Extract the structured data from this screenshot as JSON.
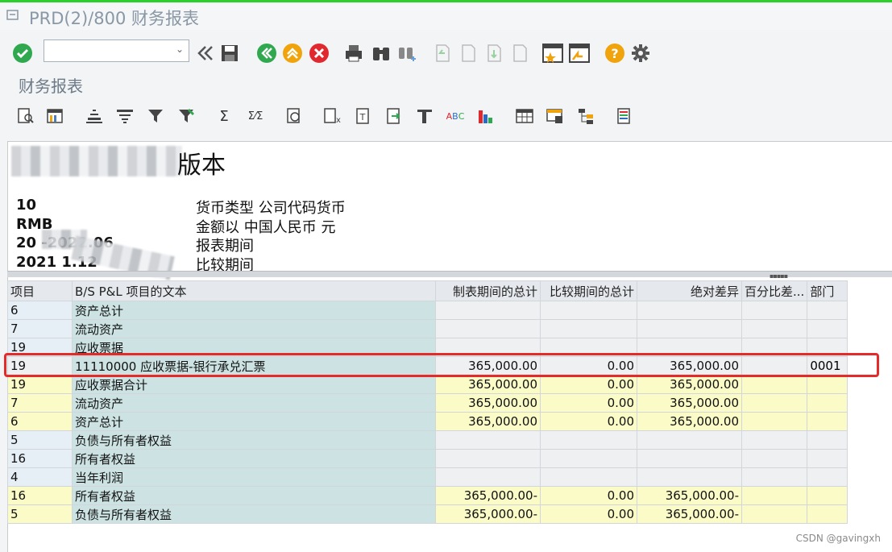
{
  "window": {
    "title": "PRD(2)/800 财务报表",
    "subtitle": "财务报表"
  },
  "command_field": {
    "value": "",
    "placeholder": ""
  },
  "report_header": {
    "title_suffix": "版本",
    "rows": [
      {
        "left": "10",
        "right": "货币类型 公司代码货币"
      },
      {
        "left": "RMB",
        "right": "金额以 中国人民币 元"
      },
      {
        "left": "20      -2022.06",
        "right": "报表期间"
      },
      {
        "left": "2021          1.12",
        "right": "比较期间"
      }
    ]
  },
  "grid": {
    "columns": [
      "项目",
      "B/S P&L 项目的文本",
      "制表期间的总计",
      "比较期间的总计",
      "绝对差异",
      "百分比差...",
      "部门"
    ],
    "rows": [
      {
        "kind": "plain",
        "cells": [
          "6",
          "资产总计",
          "",
          "",
          "",
          "",
          ""
        ]
      },
      {
        "kind": "plain",
        "cells": [
          "7",
          "流动资产",
          "",
          "",
          "",
          "",
          ""
        ]
      },
      {
        "kind": "plain",
        "cells": [
          "19",
          "应收票据",
          "",
          "",
          "",
          "",
          ""
        ]
      },
      {
        "kind": "item",
        "cells": [
          "19",
          "11110000 应收票据-银行承兑汇票",
          "365,000.00",
          "0.00",
          "365,000.00",
          "",
          "0001"
        ]
      },
      {
        "kind": "sum",
        "cells": [
          "19",
          "应收票据合计",
          "365,000.00",
          "0.00",
          "365,000.00",
          "",
          ""
        ]
      },
      {
        "kind": "sum",
        "cells": [
          "7",
          "流动资产",
          "365,000.00",
          "0.00",
          "365,000.00",
          "",
          ""
        ]
      },
      {
        "kind": "sum",
        "cells": [
          "6",
          "资产总计",
          "365,000.00",
          "0.00",
          "365,000.00",
          "",
          ""
        ]
      },
      {
        "kind": "plain",
        "cells": [
          "5",
          "负债与所有者权益",
          "",
          "",
          "",
          "",
          ""
        ]
      },
      {
        "kind": "plain",
        "cells": [
          "16",
          "所有者权益",
          "",
          "",
          "",
          "",
          ""
        ]
      },
      {
        "kind": "plain",
        "cells": [
          "4",
          "当年利润",
          "",
          "",
          "",
          "",
          ""
        ]
      },
      {
        "kind": "sum",
        "cells": [
          "16",
          "所有者权益",
          "365,000.00-",
          "0.00",
          "365,000.00-",
          "",
          ""
        ]
      },
      {
        "kind": "sum",
        "cells": [
          "5",
          "负债与所有者权益",
          "365,000.00-",
          "0.00",
          "365,000.00-",
          "",
          ""
        ]
      }
    ]
  },
  "watermark": "CSDN @gavingxh",
  "colors": {
    "accent_green": "#2bd12b",
    "highlight_red": "#e52a2a",
    "sum_yellow": "#fbfbc8",
    "text_teal": "#cde3e3"
  },
  "icons": {
    "toolbar1": [
      "check-icon",
      "back-icon",
      "save-icon",
      "back-green-icon",
      "exit-icon",
      "cancel-icon",
      "print-icon",
      "find-icon",
      "find-next-icon",
      "first-page-icon",
      "prev-page-icon",
      "next-page-icon",
      "last-page-icon",
      "new-window-icon",
      "shortcut-icon",
      "help-icon",
      "settings-icon"
    ],
    "toolbar2": [
      "detail-icon",
      "layout-icon",
      "sort-asc-icon",
      "sort-desc-icon",
      "filter-icon",
      "filter-set-icon",
      "sum-icon",
      "subtotal-icon",
      "print-preview-icon",
      "export-excel-icon",
      "word-icon",
      "local-file-icon",
      "mail-icon",
      "abc-icon",
      "graphic-icon",
      "layout-select-icon",
      "layout-save-icon",
      "layout-manage-icon",
      "info-icon"
    ]
  }
}
